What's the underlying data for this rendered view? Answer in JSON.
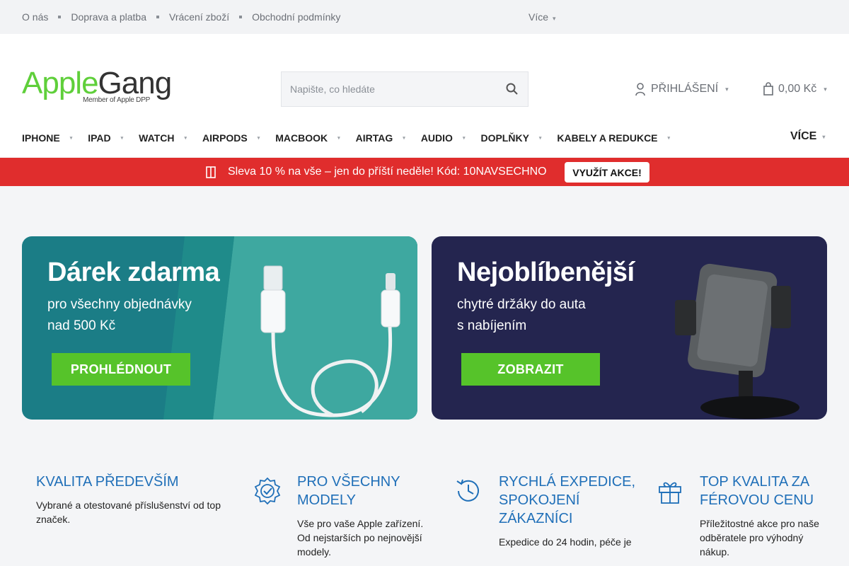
{
  "topbar": {
    "links": [
      "O nás",
      "Doprava a platba",
      "Vrácení zboží",
      "Obchodní podmínky"
    ],
    "more": "Více"
  },
  "logo": {
    "part1": "Apple",
    "part2": "Gang",
    "tagline": "Member of Apple DPP"
  },
  "search": {
    "placeholder": "Napište, co hledáte"
  },
  "login": {
    "label": "PŘIHLÁŠENÍ"
  },
  "cart": {
    "total": "0,00 Kč"
  },
  "nav": {
    "items": [
      "IPHONE",
      "IPAD",
      "WATCH",
      "AIRPODS",
      "MACBOOK",
      "AIRTAG",
      "AUDIO",
      "DOPLŇKY",
      "KABELY A REDUKCE"
    ],
    "more": "VÍCE"
  },
  "promo": {
    "text": " Sleva 10 % na vše – jen do příští neděle! Kód: 10NAVSECHNO",
    "button": "VYUŽÍT AKCE!"
  },
  "banners": [
    {
      "title": "Dárek zdarma",
      "line1": "pro všechny objednávky",
      "line2": "nad 500 Kč",
      "cta": "PROHLÉDNOUT"
    },
    {
      "title": "Nejoblíbenější",
      "line1": "chytré držáky do auta",
      "line2": "s nabíjením",
      "cta": "ZOBRAZIT"
    }
  ],
  "features": [
    {
      "title": "KVALITA PŘEDEVŠÍM",
      "desc": "Vybrané a otestované příslušenství od top značek."
    },
    {
      "title": "PRO VŠECHNY MODELY",
      "desc": "Vše pro vaše Apple zařízení. Od nejstarších po nejnovější modely."
    },
    {
      "title": "RYCHLÁ EXPEDICE, SPOKOJENÍ ZÁKAZNÍCI",
      "desc": "Expedice do 24 hodin, péče je"
    },
    {
      "title": "TOP KVALITA ZA FÉROVOU CENU",
      "desc": "Příležitostné akce pro naše odběratele pro výhodný nákup."
    }
  ],
  "colors": {
    "accent": "#1f6fb8",
    "brand_green": "#5fcf3a",
    "promo_red": "#e02d2d"
  }
}
